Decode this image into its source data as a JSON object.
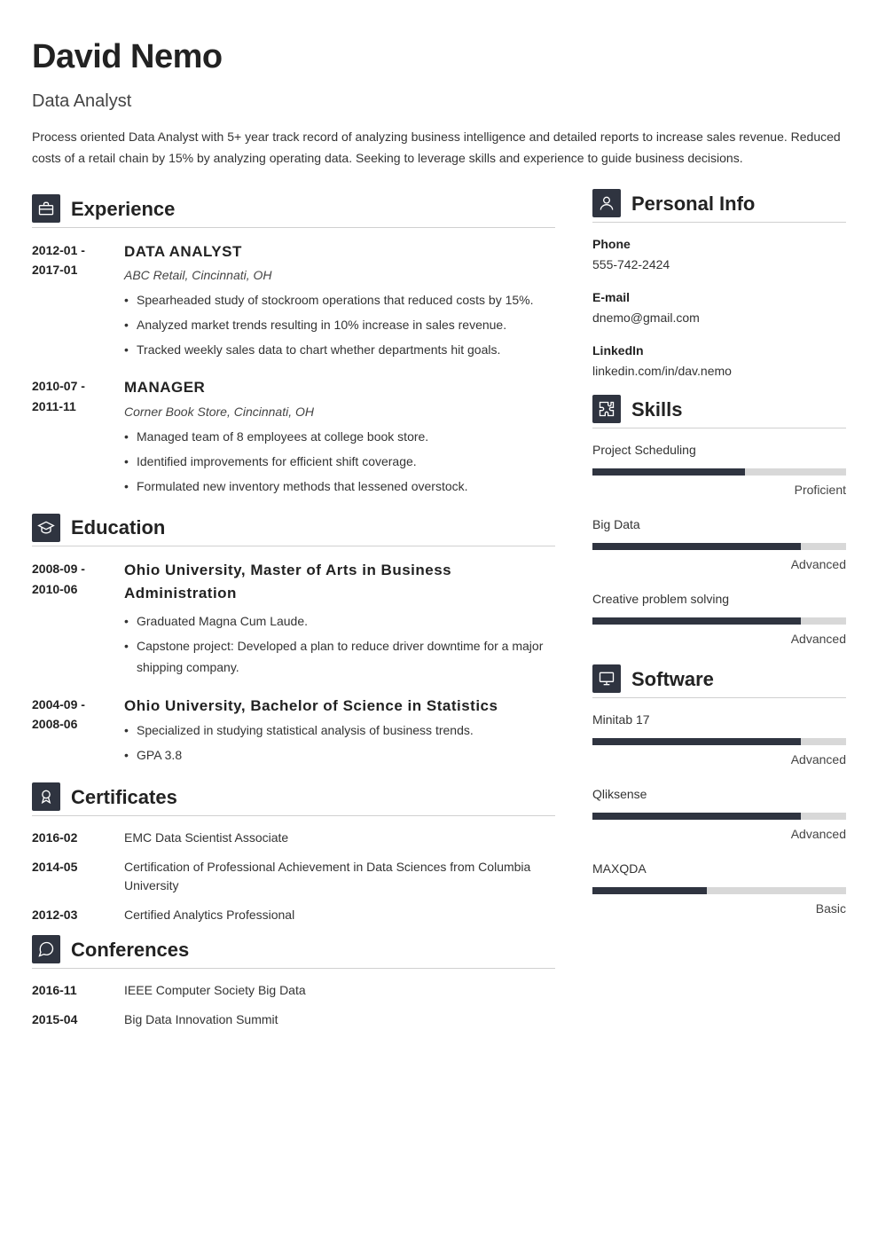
{
  "header": {
    "name": "David Nemo",
    "title": "Data Analyst",
    "summary": "Process oriented Data Analyst with 5+ year track record of analyzing business intelligence and detailed reports to increase sales revenue. Reduced costs of a retail chain by 15% by analyzing operating data. Seeking to leverage skills and experience to guide business decisions."
  },
  "sections": {
    "experience": "Experience",
    "education": "Education",
    "certificates": "Certificates",
    "conferences": "Conferences",
    "personal": "Personal Info",
    "skills": "Skills",
    "software": "Software"
  },
  "experience": [
    {
      "dates": "2012-01 - 2017-01",
      "role": "DATA ANALYST",
      "org": "ABC Retail, Cincinnati, OH",
      "points": [
        "Spearheaded study of stockroom operations that reduced costs by 15%.",
        "Analyzed market trends resulting in 10% increase in sales revenue.",
        "Tracked weekly sales data to chart whether departments hit goals."
      ]
    },
    {
      "dates": "2010-07 - 2011-11",
      "role": "MANAGER",
      "org": "Corner Book Store, Cincinnati, OH",
      "points": [
        "Managed team of 8 employees at college book store.",
        "Identified improvements for efficient shift coverage.",
        "Formulated new inventory methods that lessened overstock."
      ]
    }
  ],
  "education": [
    {
      "dates": "2008-09 - 2010-06",
      "role": "Ohio University, Master of Arts in Business Administration",
      "points": [
        "Graduated Magna Cum Laude.",
        "Capstone project: Developed a plan to reduce driver downtime for a major shipping company."
      ]
    },
    {
      "dates": "2004-09 - 2008-06",
      "role": "Ohio University, Bachelor of Science in Statistics",
      "points": [
        "Specialized in studying statistical analysis of business trends.",
        "GPA 3.8"
      ]
    }
  ],
  "certificates": [
    {
      "dates": "2016-02",
      "text": "EMC Data Scientist Associate"
    },
    {
      "dates": "2014-05",
      "text": "Certification of Professional Achievement in Data Sciences from Columbia University"
    },
    {
      "dates": "2012-03",
      "text": "Certified Analytics Professional"
    }
  ],
  "conferences": [
    {
      "dates": "2016-11",
      "text": "IEEE Computer Society Big Data"
    },
    {
      "dates": "2015-04",
      "text": "Big Data Innovation Summit"
    }
  ],
  "personal": {
    "phone_label": "Phone",
    "phone": "555-742-2424",
    "email_label": "E-mail",
    "email": "dnemo@gmail.com",
    "linkedin_label": "LinkedIn",
    "linkedin": "linkedin.com/in/dav.nemo"
  },
  "skills": [
    {
      "name": "Project Scheduling",
      "level": "proficient",
      "level_label": "Proficient"
    },
    {
      "name": "Big Data",
      "level": "advanced",
      "level_label": "Advanced"
    },
    {
      "name": "Creative problem solving",
      "level": "advanced",
      "level_label": "Advanced"
    }
  ],
  "software": [
    {
      "name": "Minitab 17",
      "level": "advanced",
      "level_label": "Advanced"
    },
    {
      "name": "Qliksense",
      "level": "advanced",
      "level_label": "Advanced"
    },
    {
      "name": "MAXQDA",
      "level": "basic",
      "level_label": "Basic"
    }
  ]
}
